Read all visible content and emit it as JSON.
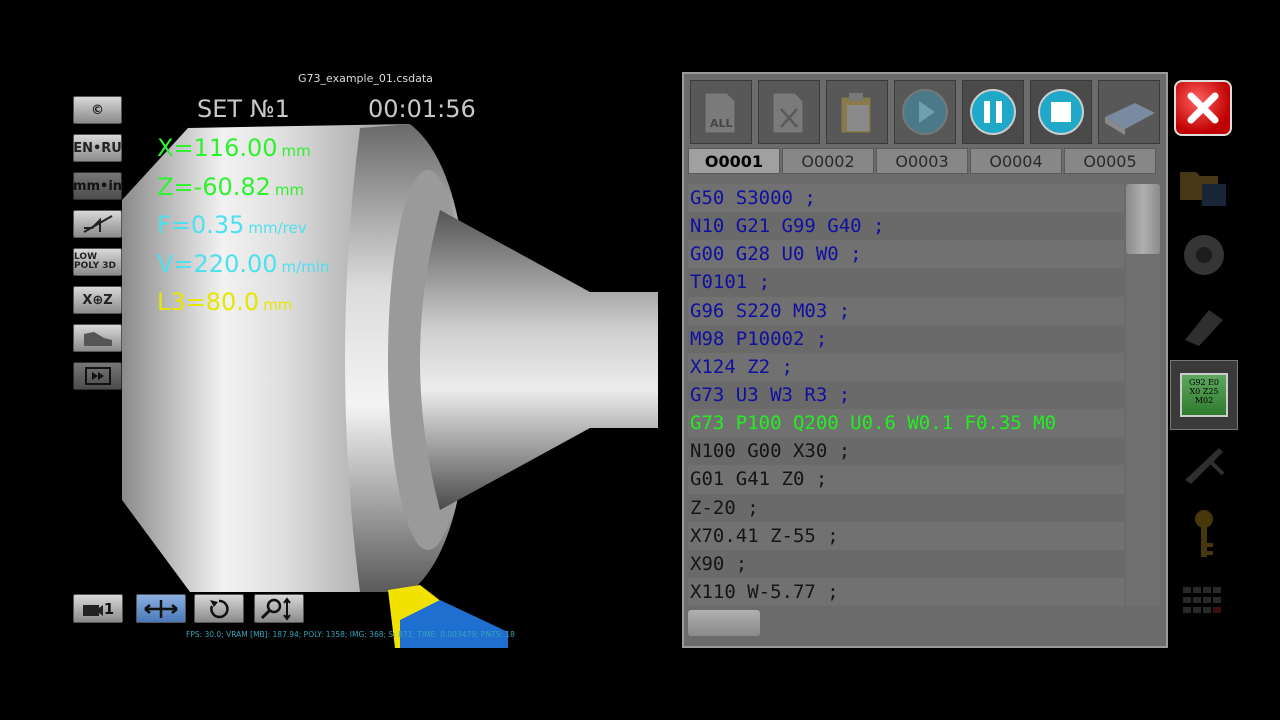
{
  "viewport": {
    "file_title": "G73_example_01.csdata",
    "set_label": "SET №1",
    "timer": "00:01:56",
    "readouts": {
      "x": {
        "text": "X=116.00",
        "unit": "mm"
      },
      "z": {
        "text": "Z=-60.82",
        "unit": "mm"
      },
      "f": {
        "text": "F=0.35",
        "unit": "mm/rev"
      },
      "v": {
        "text": "V=220.00",
        "unit": "m/min"
      },
      "l3": {
        "text": "L3=80.0",
        "unit": "mm"
      }
    },
    "left_buttons": [
      "©",
      "EN•RU",
      "mm•in",
      "",
      "LOW POLY 3D",
      "X⊕Z",
      "",
      ""
    ],
    "bottom_buttons": {
      "camera_label": "1"
    },
    "stats": "FPS: 30.0; VRAM [MB]: 187.94; POLY: 1358; IMG: 368; S: 871; TIME: 0.003479; PNTS: 18"
  },
  "editor": {
    "toolbar_all_label": "ALL",
    "tabs": [
      "O0001",
      "O0002",
      "O0003",
      "O0004",
      "O0005"
    ],
    "lines": [
      "G50 S3000 ;",
      "N10 G21 G99 G40 ;",
      "G00 G28 U0 W0 ;",
      "T0101 ;",
      "G96 S220 M03 ;",
      "M98 P10002 ;",
      "X124 Z2 ;",
      "G73 U3 W3 R3 ;",
      "G73 P100 Q200 U0.6 W0.1 F0.35 M0",
      "N100 G00 X30 ;",
      "G01 G41 Z0 ;",
      "Z-20 ;",
      "X70.41 Z-55 ;",
      "X90 ;",
      "X110 W-5.77 ;"
    ],
    "current_line_index": 8,
    "colors": {
      "code": "#1010a0",
      "current": "#22ee22",
      "plain": "#151515"
    }
  },
  "side": {
    "program_icon_text": [
      "G92 E0",
      "X0 Z25",
      "M02"
    ]
  }
}
